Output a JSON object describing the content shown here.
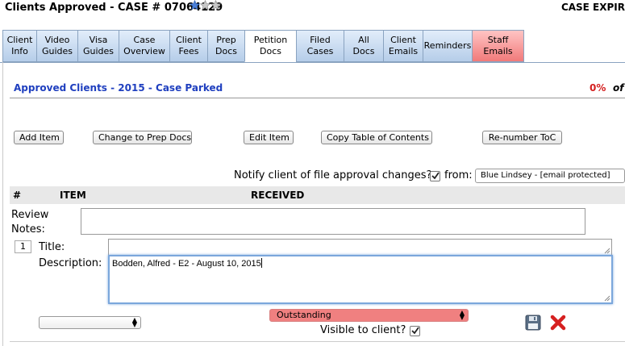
{
  "header": {
    "title": "Clients Approved - CASE # 07064129",
    "case_expir": "CASE EXPIR",
    "stars": {
      "filled": 1,
      "total": 3
    }
  },
  "tabs": [
    {
      "label": "Client\nInfo"
    },
    {
      "label": "Video\nGuides"
    },
    {
      "label": "Visa\nGuides"
    },
    {
      "label": "Case\nOverview"
    },
    {
      "label": "Client\nFees"
    },
    {
      "label": "Prep\nDocs"
    },
    {
      "label": "Petition\nDocs",
      "active": true
    },
    {
      "label": "Filed\nCases"
    },
    {
      "label": "All\nDocs"
    },
    {
      "label": "Client\nEmails"
    },
    {
      "label": "Reminders"
    },
    {
      "label": "Staff\nEmails",
      "red": true
    }
  ],
  "section": {
    "title": "Approved Clients - 2015 - Case Parked",
    "percent": "0%",
    "of": "of"
  },
  "buttons": {
    "add_item": "Add Item",
    "change_prep": "Change to Prep Docs",
    "edit_item": "Edit Item",
    "copy_toc": "Copy Table of Contents",
    "renumber": "Re-number ToC"
  },
  "notify": {
    "label": "Notify client of file approval changes?",
    "checked": true,
    "from_label": "from:",
    "from_value": "Blue Lindsey - [email protected]"
  },
  "table_header": {
    "hash": "#",
    "item": "ITEM",
    "received": "RECEIVED"
  },
  "review": {
    "label": "Review\nNotes:",
    "value": ""
  },
  "item": {
    "number": "1",
    "title_label": "Title:",
    "title_value": "",
    "desc_label": "Description:",
    "desc_value": "Bodden, Alfred - E2 - August 10, 2015",
    "type_value": "",
    "status": "Outstanding",
    "visible_label": "Visible to client?",
    "visible_checked": true
  },
  "colors": {
    "accent_blue": "#1f3fbf",
    "percent_red": "#d42020",
    "status_red": "#f08080",
    "delete_red": "#d62020"
  },
  "icons": {
    "save": "floppy-disk-icon",
    "delete": "red-x-icon",
    "star": "star-icon"
  }
}
